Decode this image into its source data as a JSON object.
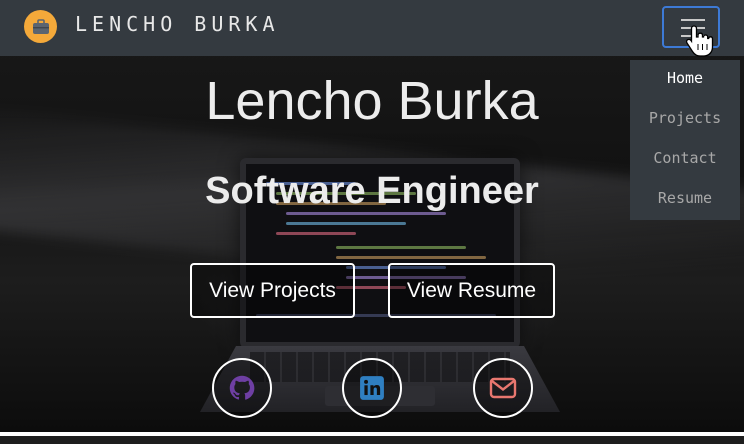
{
  "navbar": {
    "brand_name": "LENCHO BURKA",
    "brand_icon": "briefcase-icon",
    "toggler_icon": "hamburger-icon",
    "colors": {
      "background": "#343a40",
      "brand_icon_bg": "#f4a93a",
      "toggler_border": "#3d7ad6"
    }
  },
  "menu": {
    "items": [
      {
        "label": "Home",
        "active": true
      },
      {
        "label": "Projects",
        "active": false
      },
      {
        "label": "Contact",
        "active": false
      },
      {
        "label": "Resume",
        "active": false
      }
    ]
  },
  "hero": {
    "title": "Lencho Burka",
    "subtitle": "Software Engineer",
    "buttons": [
      {
        "label": "View Projects"
      },
      {
        "label": "View Resume"
      }
    ],
    "social": [
      {
        "icon": "github-icon",
        "color": "#6e3fa3"
      },
      {
        "icon": "linkedin-icon",
        "color": "#2f7fc1"
      },
      {
        "icon": "mail-icon",
        "color": "#e8776f"
      }
    ]
  }
}
